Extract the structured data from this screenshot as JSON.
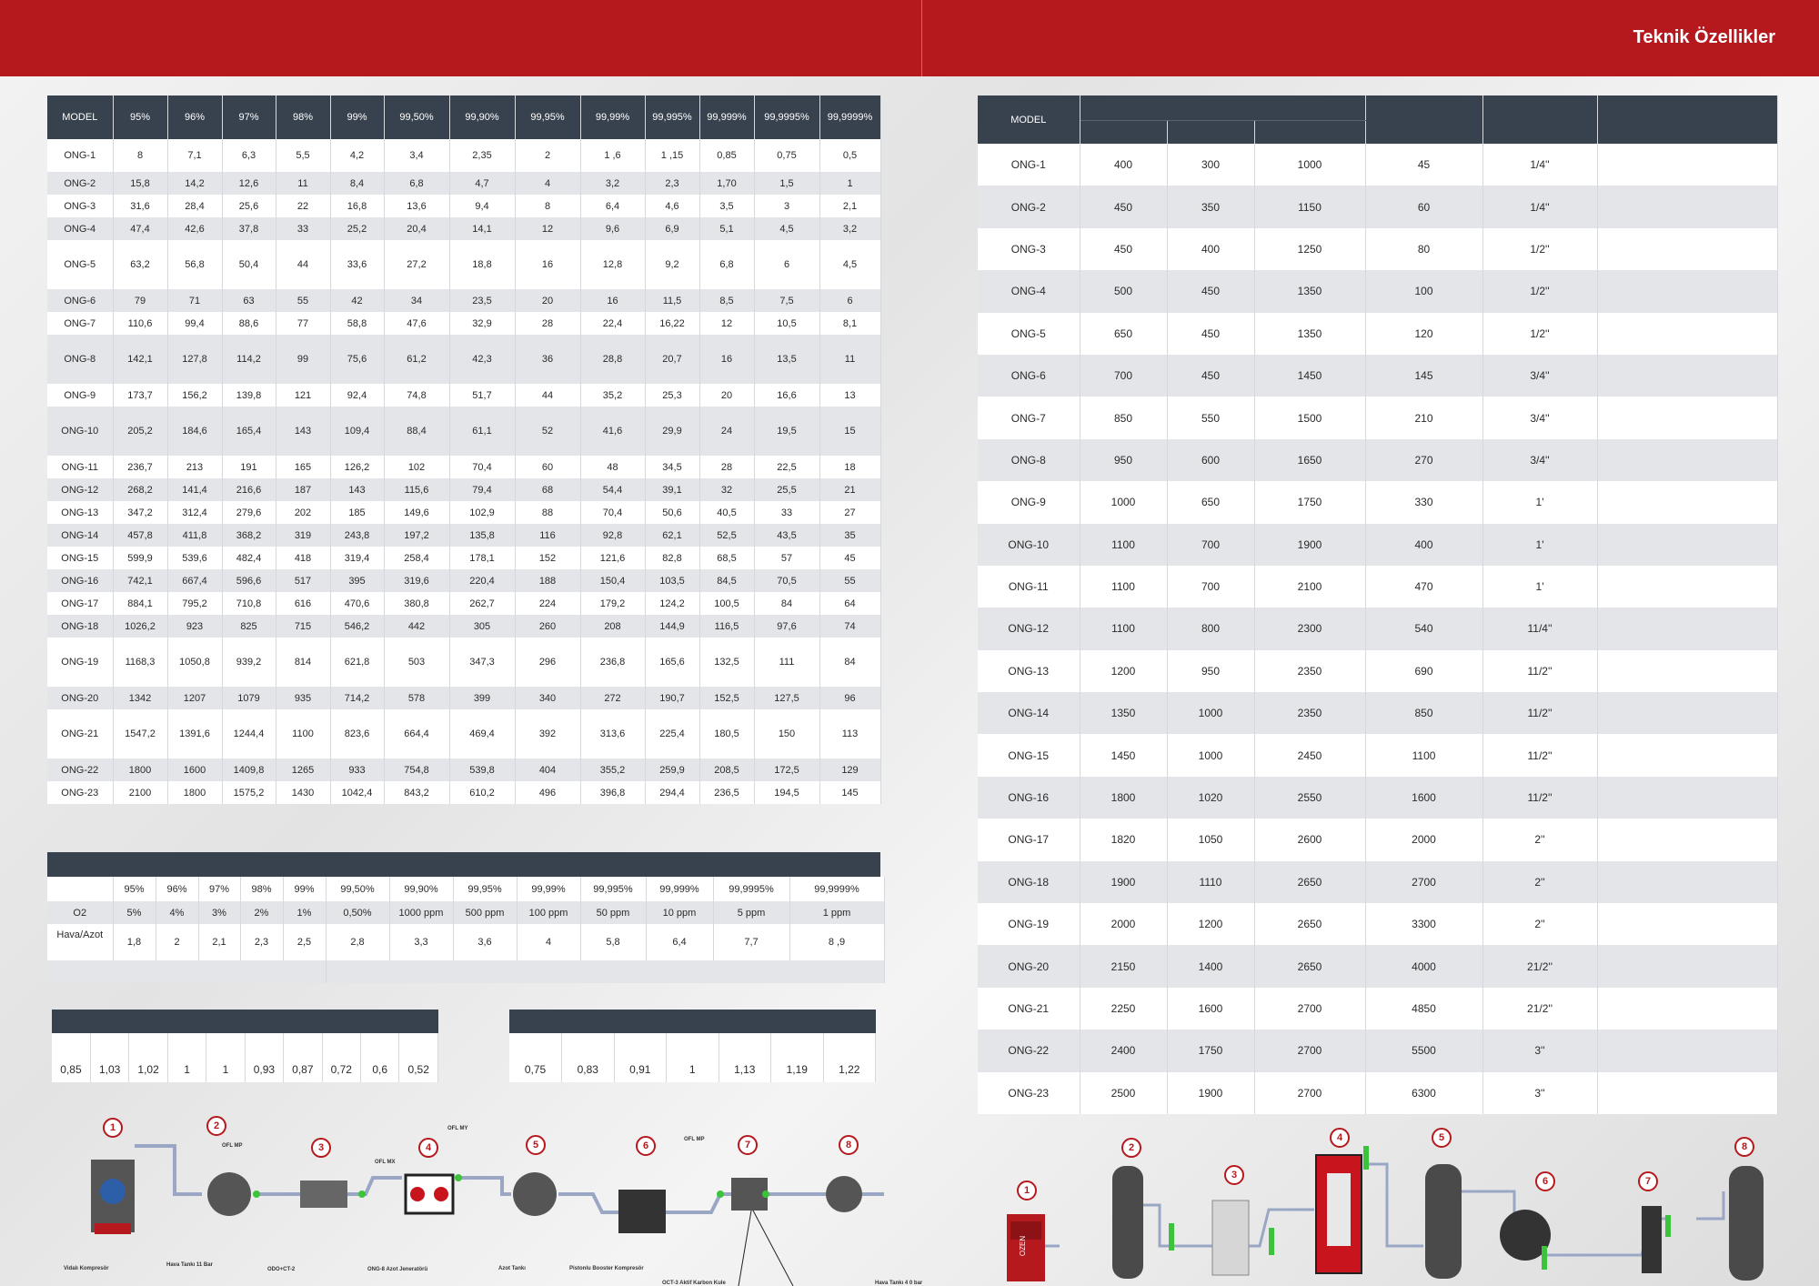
{
  "header": {
    "title": "Teknik Özellikler"
  },
  "left_table": {
    "headers": [
      "MODEL",
      "95%",
      "96%",
      "97%",
      "98%",
      "99%",
      "99,50%",
      "99,90%",
      "99,95%",
      "99,99%",
      "99,995%",
      "99,999%",
      "99,9995%",
      "99,9999%"
    ],
    "rows": [
      [
        "ONG-1",
        "8",
        "7,1",
        "6,3",
        "5,5",
        "4,2",
        "3,4",
        "2,35",
        "2",
        "1 ,6",
        "1 ,15",
        "0,85",
        "0,75",
        "0,5"
      ],
      [
        "ONG-2",
        "15,8",
        "14,2",
        "12,6",
        "11",
        "8,4",
        "6,8",
        "4,7",
        "4",
        "3,2",
        "2,3",
        "1,70",
        "1,5",
        "1"
      ],
      [
        "ONG-3",
        "31,6",
        "28,4",
        "25,6",
        "22",
        "16,8",
        "13,6",
        "9,4",
        "8",
        "6,4",
        "4,6",
        "3,5",
        "3",
        "2,1"
      ],
      [
        "ONG-4",
        "47,4",
        "42,6",
        "37,8",
        "33",
        "25,2",
        "20,4",
        "14,1",
        "12",
        "9,6",
        "6,9",
        "5,1",
        "4,5",
        "3,2"
      ],
      [
        "ONG-5",
        "63,2",
        "56,8",
        "50,4",
        "44",
        "33,6",
        "27,2",
        "18,8",
        "16",
        "12,8",
        "9,2",
        "6,8",
        "6",
        "4,5"
      ],
      [
        "ONG-6",
        "79",
        "71",
        "63",
        "55",
        "42",
        "34",
        "23,5",
        "20",
        "16",
        "11,5",
        "8,5",
        "7,5",
        "6"
      ],
      [
        "ONG-7",
        "110,6",
        "99,4",
        "88,6",
        "77",
        "58,8",
        "47,6",
        "32,9",
        "28",
        "22,4",
        "16,22",
        "12",
        "10,5",
        "8,1"
      ],
      [
        "ONG-8",
        "142,1",
        "127,8",
        "114,2",
        "99",
        "75,6",
        "61,2",
        "42,3",
        "36",
        "28,8",
        "20,7",
        "16",
        "13,5",
        "11"
      ],
      [
        "ONG-9",
        "173,7",
        "156,2",
        "139,8",
        "121",
        "92,4",
        "74,8",
        "51,7",
        "44",
        "35,2",
        "25,3",
        "20",
        "16,6",
        "13"
      ],
      [
        "ONG-10",
        "205,2",
        "184,6",
        "165,4",
        "143",
        "109,4",
        "88,4",
        "61,1",
        "52",
        "41,6",
        "29,9",
        "24",
        "19,5",
        "15"
      ],
      [
        "ONG-11",
        "236,7",
        "213",
        "191",
        "165",
        "126,2",
        "102",
        "70,4",
        "60",
        "48",
        "34,5",
        "28",
        "22,5",
        "18"
      ],
      [
        "ONG-12",
        "268,2",
        "141,4",
        "216,6",
        "187",
        "143",
        "115,6",
        "79,4",
        "68",
        "54,4",
        "39,1",
        "32",
        "25,5",
        "21"
      ],
      [
        "ONG-13",
        "347,2",
        "312,4",
        "279,6",
        "202",
        "185",
        "149,6",
        "102,9",
        "88",
        "70,4",
        "50,6",
        "40,5",
        "33",
        "27"
      ],
      [
        "ONG-14",
        "457,8",
        "411,8",
        "368,2",
        "319",
        "243,8",
        "197,2",
        "135,8",
        "116",
        "92,8",
        "62,1",
        "52,5",
        "43,5",
        "35"
      ],
      [
        "ONG-15",
        "599,9",
        "539,6",
        "482,4",
        "418",
        "319,4",
        "258,4",
        "178,1",
        "152",
        "121,6",
        "82,8",
        "68,5",
        "57",
        "45"
      ],
      [
        "ONG-16",
        "742,1",
        "667,4",
        "596,6",
        "517",
        "395",
        "319,6",
        "220,4",
        "188",
        "150,4",
        "103,5",
        "84,5",
        "70,5",
        "55"
      ],
      [
        "ONG-17",
        "884,1",
        "795,2",
        "710,8",
        "616",
        "470,6",
        "380,8",
        "262,7",
        "224",
        "179,2",
        "124,2",
        "100,5",
        "84",
        "64"
      ],
      [
        "ONG-18",
        "1026,2",
        "923",
        "825",
        "715",
        "546,2",
        "442",
        "305",
        "260",
        "208",
        "144,9",
        "116,5",
        "97,6",
        "74"
      ],
      [
        "ONG-19",
        "1168,3",
        "1050,8",
        "939,2",
        "814",
        "621,8",
        "503",
        "347,3",
        "296",
        "236,8",
        "165,6",
        "132,5",
        "111",
        "84"
      ],
      [
        "ONG-20",
        "1342",
        "1207",
        "1079",
        "935",
        "714,2",
        "578",
        "399",
        "340",
        "272",
        "190,7",
        "152,5",
        "127,5",
        "96"
      ],
      [
        "ONG-21",
        "1547,2",
        "1391,6",
        "1244,4",
        "1100",
        "823,6",
        "664,4",
        "469,4",
        "392",
        "313,6",
        "225,4",
        "180,5",
        "150",
        "113"
      ],
      [
        "ONG-22",
        "1800",
        "1600",
        "1409,8",
        "1265",
        "933",
        "754,8",
        "539,8",
        "404",
        "355,2",
        "259,9",
        "208,5",
        "172,5",
        "129"
      ],
      [
        "ONG-23",
        "2100",
        "1800",
        "1575,2",
        "1430",
        "1042,4",
        "843,2",
        "610,2",
        "496",
        "396,8",
        "294,4",
        "236,5",
        "194,5",
        "145"
      ]
    ]
  },
  "purity_table": {
    "headers": [
      "",
      "95%",
      "96%",
      "97%",
      "98%",
      "99%",
      "99,50%",
      "99,90%",
      "99,95%",
      "99,99%",
      "99,995%",
      "99,999%",
      "99,9995%",
      "99,9999%"
    ],
    "o2": [
      "O2",
      "5%",
      "4%",
      "3%",
      "2%",
      "1%",
      "0,50%",
      "1000 ppm",
      "500 ppm",
      "100 ppm",
      "50 ppm",
      "10 ppm",
      "5 ppm",
      "1 ppm"
    ],
    "ratio": [
      "Hava/Azot",
      "1,8",
      "2",
      "2,1",
      "2,3",
      "2,5",
      "2,8",
      "3,3",
      "3,6",
      "4",
      "5,8",
      "6,4",
      "7,7",
      "8 ,9"
    ]
  },
  "factor_left": [
    "0,85",
    "1,03",
    "1,02",
    "1",
    "1",
    "0,93",
    "0,87",
    "0,72",
    "0,6",
    "0,52"
  ],
  "factor_right": [
    "0,75",
    "0,83",
    "0,91",
    "1",
    "1,13",
    "1,19",
    "1,22"
  ],
  "right_table": {
    "header_model": "MODEL",
    "rows": [
      [
        "ONG-1",
        "400",
        "300",
        "1000",
        "45",
        "1/4''"
      ],
      [
        "ONG-2",
        "450",
        "350",
        "1150",
        "60",
        "1/4''"
      ],
      [
        "ONG-3",
        "450",
        "400",
        "1250",
        "80",
        "1/2''"
      ],
      [
        "ONG-4",
        "500",
        "450",
        "1350",
        "100",
        "1/2''"
      ],
      [
        "ONG-5",
        "650",
        "450",
        "1350",
        "120",
        "1/2''"
      ],
      [
        "ONG-6",
        "700",
        "450",
        "1450",
        "145",
        "3/4''"
      ],
      [
        "ONG-7",
        "850",
        "550",
        "1500",
        "210",
        "3/4''"
      ],
      [
        "ONG-8",
        "950",
        "600",
        "1650",
        "270",
        "3/4''"
      ],
      [
        "ONG-9",
        "1000",
        "650",
        "1750",
        "330",
        "1'"
      ],
      [
        "ONG-10",
        "1100",
        "700",
        "1900",
        "400",
        "1'"
      ],
      [
        "ONG-11",
        "1100",
        "700",
        "2100",
        "470",
        "1'"
      ],
      [
        "ONG-12",
        "1100",
        "800",
        "2300",
        "540",
        "11/4''"
      ],
      [
        "ONG-13",
        "1200",
        "950",
        "2350",
        "690",
        "11/2''"
      ],
      [
        "ONG-14",
        "1350",
        "1000",
        "2350",
        "850",
        "11/2''"
      ],
      [
        "ONG-15",
        "1450",
        "1000",
        "2450",
        "1100",
        "11/2''"
      ],
      [
        "ONG-16",
        "1800",
        "1020",
        "2550",
        "1600",
        "11/2''"
      ],
      [
        "ONG-17",
        "1820",
        "1050",
        "2600",
        "2000",
        "2''"
      ],
      [
        "ONG-18",
        "1900",
        "1110",
        "2650",
        "2700",
        "2''"
      ],
      [
        "ONG-19",
        "2000",
        "1200",
        "2650",
        "3300",
        "2''"
      ],
      [
        "ONG-20",
        "2150",
        "1400",
        "2650",
        "4000",
        "21/2''"
      ],
      [
        "ONG-21",
        "2250",
        "1600",
        "2700",
        "4850",
        "21/2''"
      ],
      [
        "ONG-22",
        "2400",
        "1750",
        "2700",
        "5500",
        "3''"
      ],
      [
        "ONG-23",
        "2500",
        "1900",
        "2700",
        "6300",
        "3''"
      ]
    ]
  },
  "diagram_left": {
    "numbers": [
      "1",
      "2",
      "3",
      "4",
      "5",
      "6",
      "7",
      "8"
    ],
    "labels": [
      "Vidalı Kompresör",
      "Hava Tankı 11 Bar",
      "ODO+CT-2",
      "ONG-8 Azot Jeneratörü",
      "Azot Tankı",
      "Pistonlu Booster Kompresör",
      "OCT-3 Aktif Karbon Kule",
      "Hava Tankı 4 0 bar"
    ],
    "tags": [
      "OFL MP",
      "OFL MX",
      "OFL MY",
      "OFL MP"
    ]
  },
  "diagram_right": {
    "numbers": [
      "1",
      "2",
      "3",
      "4",
      "5",
      "6",
      "7",
      "8"
    ],
    "brand": "OZEN"
  },
  "colors": {
    "brand_red": "#b5191e",
    "header_dark": "#38424f",
    "row_alt": "#e3e5e8",
    "pipe_green": "#3bc43b"
  }
}
